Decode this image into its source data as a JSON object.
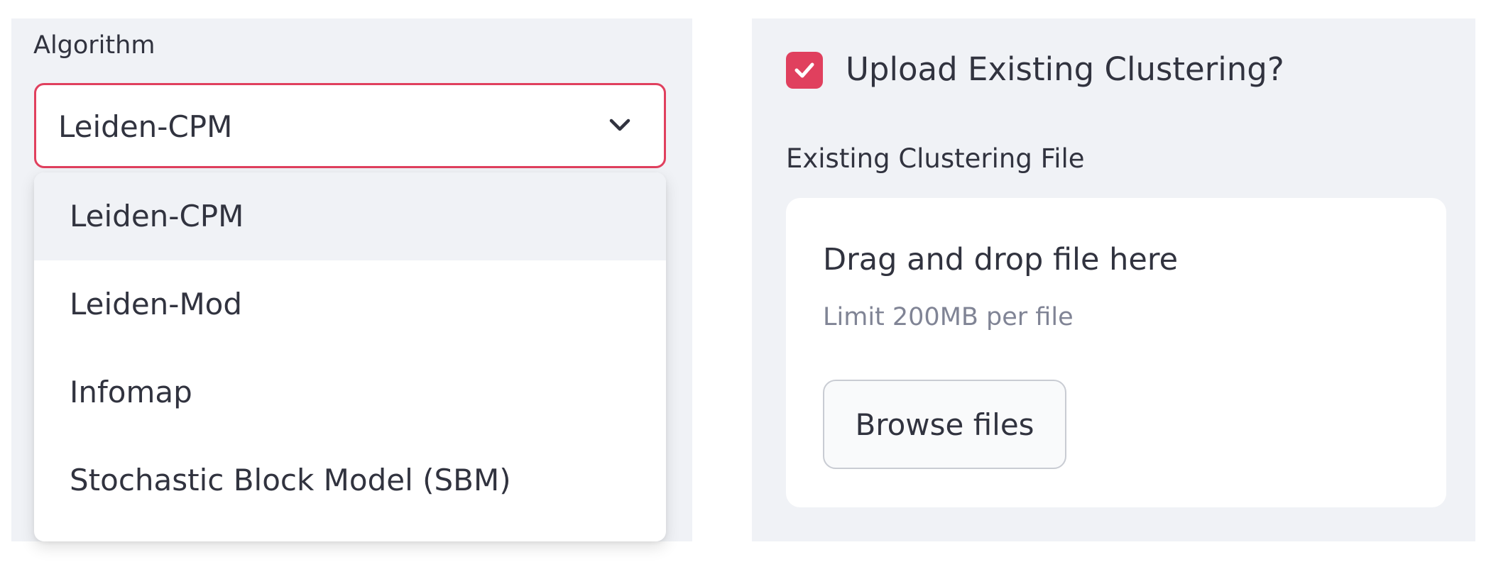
{
  "algorithm": {
    "label": "Algorithm",
    "selected": "Leiden-CPM",
    "options": [
      "Leiden-CPM",
      "Leiden-Mod",
      "Infomap",
      "Stochastic Block Model (SBM)"
    ],
    "highlighted_option": "Leiden-CPM"
  },
  "upload": {
    "checkbox_label": "Upload Existing Clustering?",
    "checkbox_checked": true,
    "file_label": "Existing Clustering File",
    "drop_title": "Drag and drop file here",
    "limit_text": "Limit 200MB per file",
    "browse_label": "Browse files"
  },
  "colors": {
    "accent": "#e0405e",
    "panel_bg": "#f0f2f6",
    "text": "#31333f",
    "muted_text": "#808495"
  },
  "icons": {
    "select_chevron": "chevron-down-icon",
    "checkbox_mark": "check-icon"
  }
}
